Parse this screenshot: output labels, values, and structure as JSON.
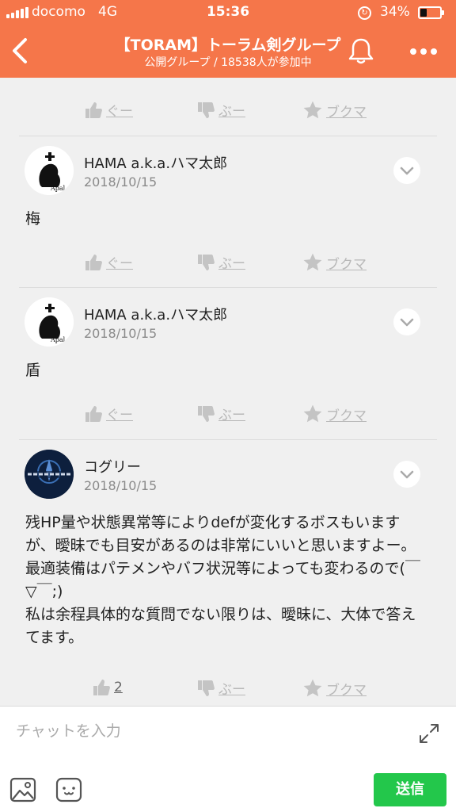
{
  "status_bar": {
    "carrier": "docomo",
    "network": "4G",
    "time": "15:36",
    "battery_percent_text": "34%",
    "battery_level": 0.34
  },
  "header": {
    "title": "【TORAM】トーラム剣グループ",
    "subtitle": "公開グループ / 18538人が参加中",
    "background_color": "#f5764a",
    "back_icon": "chevron-left-icon",
    "notify_icon": "bell-icon",
    "more_icon": "more-dots-icon"
  },
  "top_reactions": {
    "like_label": "ぐー",
    "dislike_label": "ぶー",
    "bookmark_label": "ブクマ"
  },
  "posts": [
    {
      "author": "HAMA a.k.a.ハマ太郎",
      "date": "2018/10/15",
      "text": "梅",
      "like_label": "ぐー",
      "dislike_label": "ぶー",
      "bookmark_label": "ブクマ"
    },
    {
      "author": "HAMA a.k.a.ハマ太郎",
      "date": "2018/10/15",
      "text": "盾",
      "like_label": "ぐー",
      "dislike_label": "ぶー",
      "bookmark_label": "ブクマ"
    },
    {
      "author": "コグリー",
      "date": "2018/10/15",
      "text": "残HP量や状態異常等によりdefが変化するボスもいますが、曖昧でも目安があるのは非常にいいと思いますよー。\n最適装備はパテメンやバフ状況等によっても変わるので(￣▽￣;)\n私は余程具体的な質問でない限りは、曖昧に、大体で答えてます。",
      "like_label": "2",
      "dislike_label": "ぶー",
      "bookmark_label": "ブクマ"
    }
  ],
  "input_bar": {
    "placeholder": "チャットを入力",
    "send_label": "送信",
    "send_color": "#23c74b",
    "image_icon": "image-icon",
    "sticker_icon": "sticker-icon",
    "expand_icon": "expand-arrows-icon"
  }
}
